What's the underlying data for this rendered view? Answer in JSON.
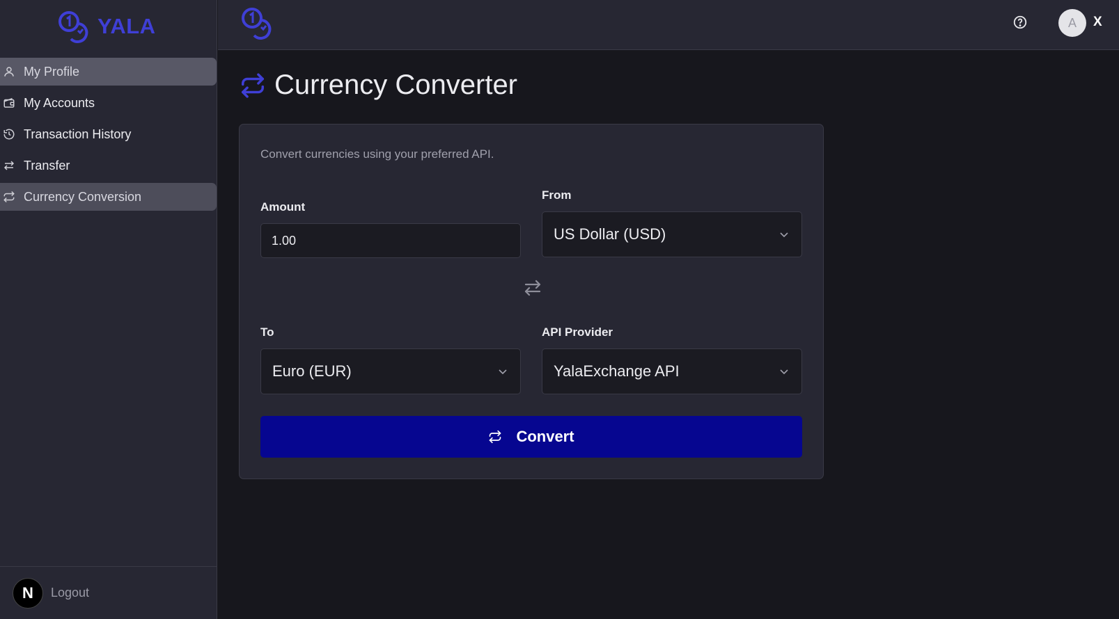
{
  "brand": {
    "name": "YALA",
    "accent": "#3f3fd6",
    "logo_icon": "coins-icon"
  },
  "sidebar": {
    "items": [
      {
        "label": "My Profile",
        "icon": "user-icon"
      },
      {
        "label": "My Accounts",
        "icon": "wallet-icon"
      },
      {
        "label": "Transaction History",
        "icon": "history-icon"
      },
      {
        "label": "Transfer",
        "icon": "transfer-arrows-icon"
      },
      {
        "label": "Currency Conversion",
        "icon": "convert-arrows-icon"
      }
    ],
    "footer": {
      "logo_letter": "N",
      "logout_label": "Logout"
    }
  },
  "topbar": {
    "help_icon": "help-circle-icon",
    "avatar_letter": "A",
    "user_initial": "X"
  },
  "page": {
    "title": "Currency Converter",
    "title_icon": "convert-arrows-icon"
  },
  "form": {
    "description": "Convert currencies using your preferred API.",
    "amount": {
      "label": "Amount",
      "value": "1.00"
    },
    "from": {
      "label": "From",
      "selected": "US Dollar (USD)"
    },
    "to": {
      "label": "To",
      "selected": "Euro (EUR)"
    },
    "provider": {
      "label": "API Provider",
      "selected": "YalaExchange API"
    },
    "swap_icon": "swap-arrows-icon",
    "convert_button": {
      "label": "Convert",
      "icon": "convert-arrows-icon",
      "color": "#060690"
    }
  }
}
